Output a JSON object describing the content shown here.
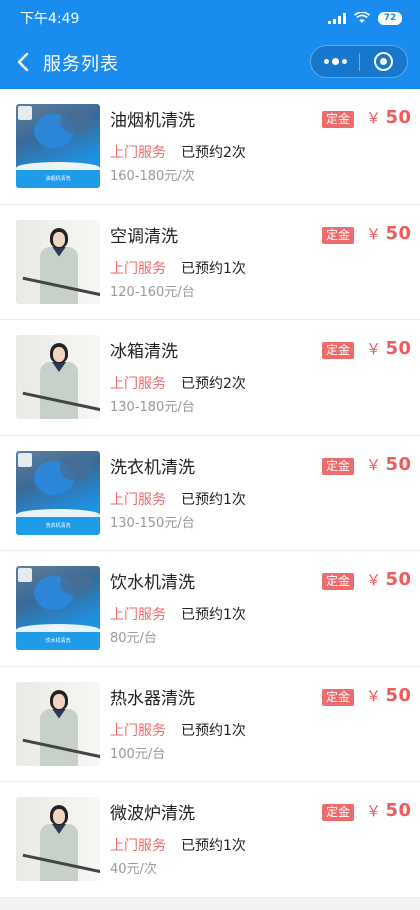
{
  "status_bar": {
    "time": "下午4:49",
    "battery": "72"
  },
  "nav": {
    "title": "服务列表"
  },
  "items": [
    {
      "name": "油烟机清洗",
      "tag": "定金",
      "currency": "￥",
      "price": "50",
      "service": "上门服务",
      "booked": "已预约2次",
      "range": "160-180元/次",
      "thumb": "tech",
      "thumb_caption": "油烟机清洗"
    },
    {
      "name": "空调清洗",
      "tag": "定金",
      "currency": "￥",
      "price": "50",
      "service": "上门服务",
      "booked": "已预约1次",
      "range": "120-160元/台",
      "thumb": "person"
    },
    {
      "name": "冰箱清洗",
      "tag": "定金",
      "currency": "￥",
      "price": "50",
      "service": "上门服务",
      "booked": "已预约2次",
      "range": "130-180元/台",
      "thumb": "person"
    },
    {
      "name": "洗衣机清洗",
      "tag": "定金",
      "currency": "￥",
      "price": "50",
      "service": "上门服务",
      "booked": "已预约1次",
      "range": "130-150元/台",
      "thumb": "tech",
      "thumb_caption": "洗衣机清洗"
    },
    {
      "name": "饮水机清洗",
      "tag": "定金",
      "currency": "￥",
      "price": "50",
      "service": "上门服务",
      "booked": "已预约1次",
      "range": "80元/台",
      "thumb": "tech",
      "thumb_caption": "饮水机清洗"
    },
    {
      "name": "热水器清洗",
      "tag": "定金",
      "currency": "￥",
      "price": "50",
      "service": "上门服务",
      "booked": "已预约1次",
      "range": "100元/台",
      "thumb": "person"
    },
    {
      "name": "微波炉清洗",
      "tag": "定金",
      "currency": "￥",
      "price": "50",
      "service": "上门服务",
      "booked": "已预约1次",
      "range": "40元/次",
      "thumb": "person"
    }
  ]
}
